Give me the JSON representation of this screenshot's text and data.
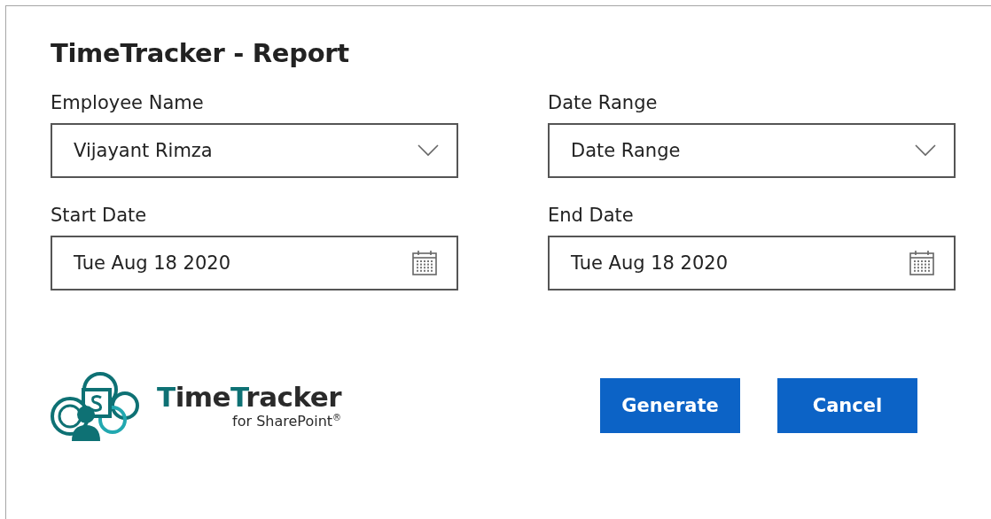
{
  "dialog": {
    "title": "TimeTracker - Report"
  },
  "fields": [
    {
      "kind": "dropdown",
      "label": "Employee Name",
      "value": "Vijayant Rimza"
    },
    {
      "kind": "dropdown",
      "label": "Date Range",
      "value": "Date Range"
    },
    {
      "kind": "date",
      "label": "Start Date",
      "value": "Tue Aug 18 2020"
    },
    {
      "kind": "date",
      "label": "End Date",
      "value": "Tue Aug 18 2020"
    }
  ],
  "logo": {
    "title_parts": [
      {
        "text": "T",
        "accent": true
      },
      {
        "text": "ime",
        "accent": false
      },
      {
        "text": "T",
        "accent": true
      },
      {
        "text": "racker",
        "accent": false
      }
    ],
    "subtitle": "for SharePoint$^{®}$"
  },
  "buttons": [
    "Generate",
    "Cancel"
  ]
}
